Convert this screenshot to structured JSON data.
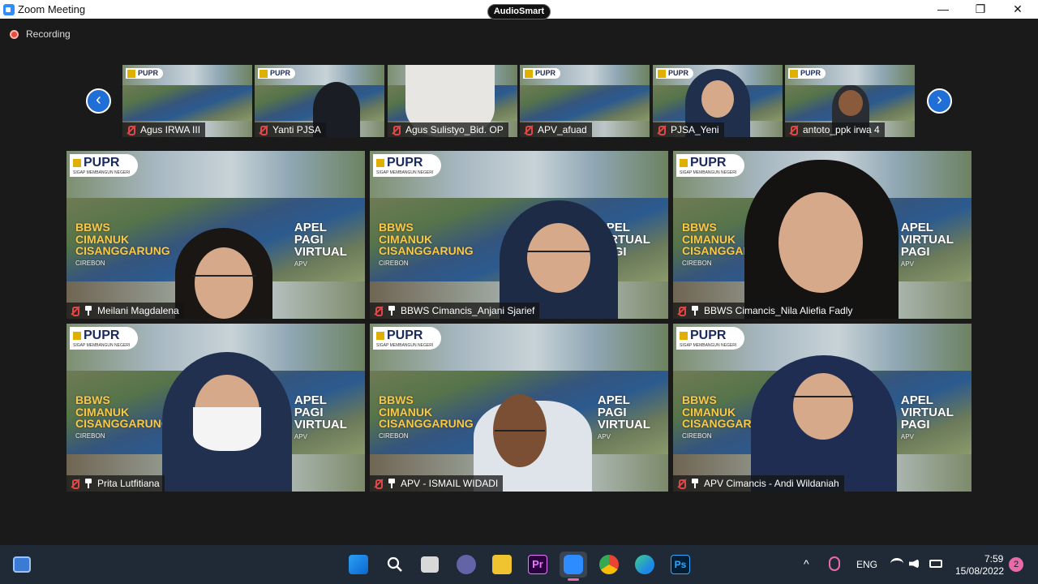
{
  "window": {
    "title": "Zoom Meeting",
    "audio_badge": "AudioSmart",
    "minimize": "—",
    "maximize": "❐",
    "close": "✕"
  },
  "recording": {
    "label": "Recording"
  },
  "strip": {
    "prev": "‹",
    "next": "›",
    "participants": [
      {
        "name": "Agus IRWA III"
      },
      {
        "name": "Yanti PJSA"
      },
      {
        "name": "Agus Sulistyo_Bid. OP"
      },
      {
        "name": "APV_afuad"
      },
      {
        "name": "PJSA_Yeni"
      },
      {
        "name": "antoto_ppk irwa 4"
      }
    ]
  },
  "background": {
    "logo": "PUPR",
    "logo_sub": "SIGAP MEMBANGUN NEGERI",
    "left_text_1": "BBWS",
    "left_text_2": "CIMANUK",
    "left_text_3": "CISANGGARUNG",
    "left_small": "CIREBON",
    "right_text_1": "APEL",
    "right_text_2": "VIRTUAL",
    "right_text_2b": "PAGI",
    "right_small": "APV"
  },
  "gallery": [
    {
      "name": "Meilani Magdalena"
    },
    {
      "name": "BBWS Cimancis_Anjani Sjarief"
    },
    {
      "name": "BBWS Cimancis_Nila Aliefia Fadly"
    },
    {
      "name": "Prita Lutfitiana"
    },
    {
      "name": "APV - ISMAIL WIDADI"
    },
    {
      "name": "APV Cimancis - Andi Wildaniah"
    }
  ],
  "taskbar": {
    "language": "ENG",
    "time": "7:59",
    "date": "15/08/2022",
    "notifications": "2",
    "chevron": "^",
    "ps": "Ps",
    "pr": "Pr"
  },
  "colors": {
    "zoom_blue": "#2d8cff",
    "mute_red": "#e04848",
    "taskbar": "#202a36",
    "notification_badge": "#e86aa8"
  }
}
